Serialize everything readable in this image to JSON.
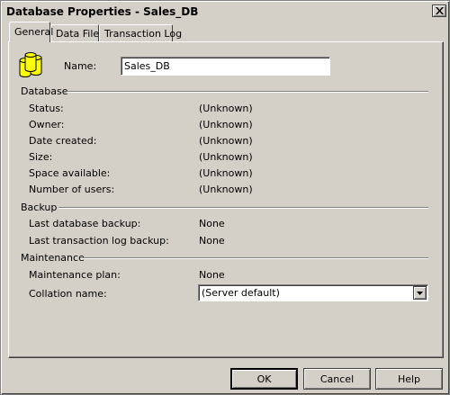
{
  "window": {
    "title": "Database Properties - Sales_DB"
  },
  "tabs": [
    {
      "label": "General",
      "active": true
    },
    {
      "label": "Data Files",
      "active": false
    },
    {
      "label": "Transaction Log",
      "active": false
    }
  ],
  "general": {
    "name_label": "Name:",
    "name_value": "Sales_DB",
    "database_section": "Database",
    "database_rows": [
      {
        "label": "Status:",
        "value": "(Unknown)"
      },
      {
        "label": "Owner:",
        "value": "(Unknown)"
      },
      {
        "label": "Date created:",
        "value": "(Unknown)"
      },
      {
        "label": "Size:",
        "value": "(Unknown)"
      },
      {
        "label": "Space available:",
        "value": "(Unknown)"
      },
      {
        "label": "Number of users:",
        "value": "(Unknown)"
      }
    ],
    "backup_section": "Backup",
    "backup_rows": [
      {
        "label": "Last database backup:",
        "value": "None"
      },
      {
        "label": "Last transaction log backup:",
        "value": "None"
      }
    ],
    "maintenance_section": "Maintenance",
    "maintenance_plan_label": "Maintenance plan:",
    "maintenance_plan_value": "None",
    "collation_label": "Collation name:",
    "collation_value": "(Server default)"
  },
  "buttons": {
    "ok": "OK",
    "cancel": "Cancel",
    "help": "Help"
  },
  "icons": {
    "database": "database-cylinders-icon",
    "close": "close-x-icon",
    "dropdown": "chevron-down-icon"
  },
  "colors": {
    "dialog_bg": "#d4d0c8",
    "db_icon_yellow": "#ffff00",
    "db_icon_outline": "#000000"
  }
}
